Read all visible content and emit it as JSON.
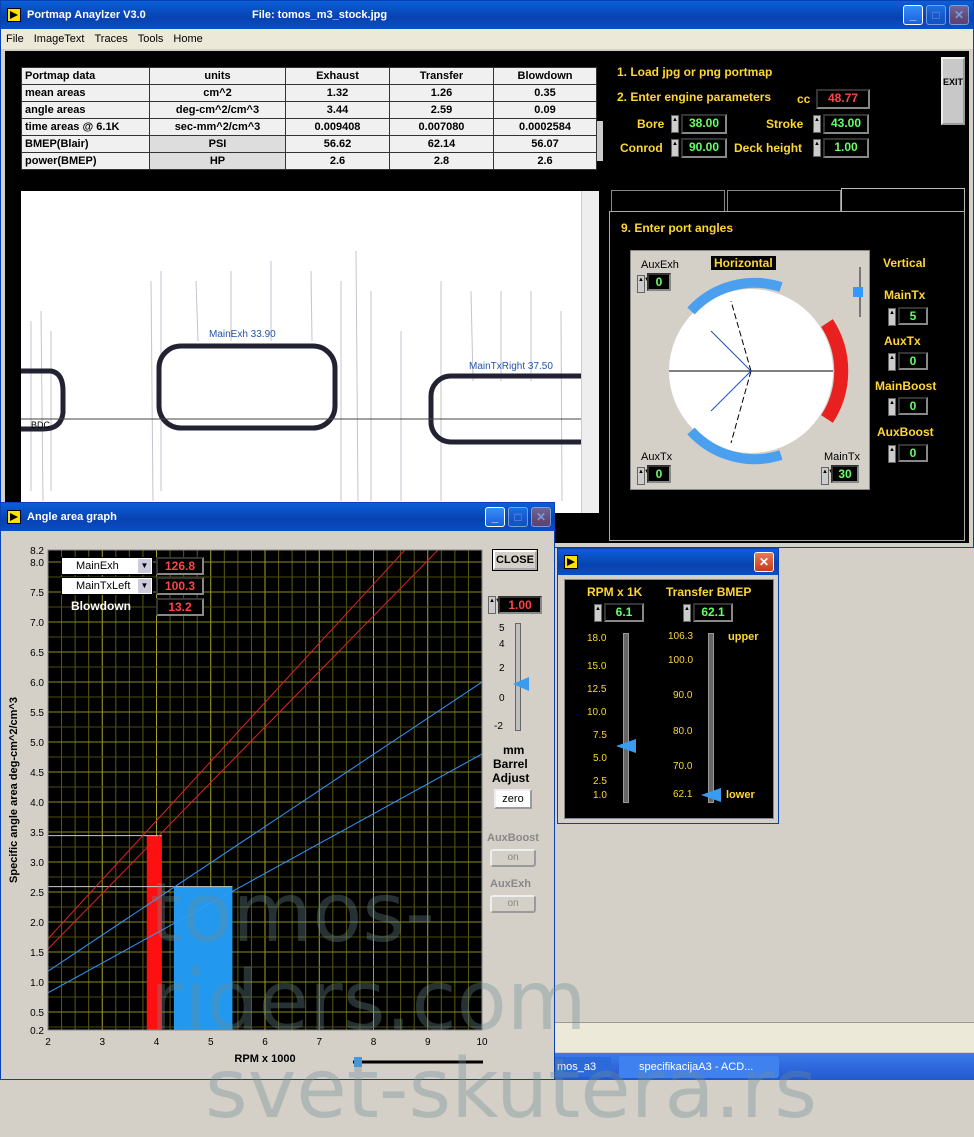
{
  "main_window": {
    "title": "Portmap Anaylzer V3.0",
    "file_label": "File: tomos_m3_stock.jpg",
    "menu": [
      "File",
      "ImageText",
      "Traces",
      "Tools",
      "Home"
    ]
  },
  "table": {
    "headers": [
      "Portmap data",
      "units",
      "Exhaust",
      "Transfer",
      "Blowdown"
    ],
    "rows": [
      [
        "mean areas",
        "cm^2",
        "1.32",
        "1.26",
        "0.35"
      ],
      [
        "angle areas",
        "deg-cm^2/cm^3",
        "3.44",
        "2.59",
        "0.09"
      ],
      [
        "time areas @ 6.1K",
        "sec-mm^2/cm^3",
        "0.009408",
        "0.007080",
        "0.0002584"
      ],
      [
        "BMEP(Blair)",
        "PSI",
        "56.62",
        "62.14",
        "56.07"
      ],
      [
        "power(BMEP)",
        "HP",
        "2.6",
        "2.8",
        "2.6"
      ]
    ]
  },
  "steps": {
    "step1": "1. Load jpg or png portmap",
    "step2": "2. Enter engine parameters",
    "step9": "9. Enter port angles"
  },
  "engine": {
    "cc_label": "cc",
    "cc": "48.77",
    "bore_label": "Bore",
    "bore": "38.00",
    "stroke_label": "Stroke",
    "stroke": "43.00",
    "conrod_label": "Conrod",
    "conrod": "90.00",
    "deck_label": "Deck height",
    "deck": "1.00"
  },
  "exit_label": "EXIT",
  "image": {
    "exh_label": "MainExh 33.90",
    "tx_label": "MainTxRight 37.50",
    "bdc_label": "BDC"
  },
  "port_angles": {
    "auxexh_label": "AuxExh",
    "auxexh": "0",
    "horizontal": "Horizontal",
    "vertical": "Vertical",
    "auxtx_label": "AuxTx",
    "auxtx": "0",
    "maintx_bottom_label": "MainTx",
    "maintx_bottom": "30",
    "vert": [
      {
        "label": "MainTx",
        "value": "5"
      },
      {
        "label": "AuxTx",
        "value": "0"
      },
      {
        "label": "MainBoost",
        "value": "0"
      },
      {
        "label": "AuxBoost",
        "value": "0"
      }
    ]
  },
  "graph_window": {
    "title": "Angle area graph",
    "close": "CLOSE",
    "legend": [
      {
        "label": "MainExh",
        "value": "126.8"
      },
      {
        "label": "MainTxLeft",
        "value": "100.3"
      },
      {
        "label": "Blowdown",
        "value": "13.2"
      }
    ],
    "adjust_value": "1.00",
    "mm": "mm",
    "barrel": "Barrel",
    "adjust": "Adjust",
    "zero": "zero",
    "auxboost": "AuxBoost",
    "auxexh": "AuxExh",
    "on": "on",
    "slider_ticks": [
      "5",
      "4",
      "2",
      "0",
      "-2"
    ]
  },
  "chart_data": {
    "type": "line",
    "xlabel": "RPM x 1000",
    "ylabel": "Specific angle area  deg-cm^2/cm^3",
    "xlim": [
      2,
      10
    ],
    "ylim": [
      0.2,
      8.2
    ],
    "xticks": [
      "2",
      "3",
      "4",
      "5",
      "6",
      "7",
      "8",
      "9",
      "10"
    ],
    "yticks": [
      "0.2",
      "0.5",
      "1.0",
      "1.5",
      "2.0",
      "2.5",
      "3.0",
      "3.5",
      "4.0",
      "4.5",
      "5.0",
      "5.5",
      "6.0",
      "6.5",
      "7.0",
      "7.5",
      "8.0",
      "8.2"
    ],
    "series": [
      {
        "name": "",
        "color": "#d22",
        "x": [
          2,
          10
        ],
        "y": [
          1.72,
          9.6
        ]
      },
      {
        "name": "",
        "color": "#d22",
        "x": [
          2,
          10
        ],
        "y": [
          1.55,
          8.95
        ]
      },
      {
        "name": "",
        "color": "#39f",
        "x": [
          2,
          10
        ],
        "y": [
          1.18,
          6.0
        ]
      },
      {
        "name": "",
        "color": "#39f",
        "x": [
          2,
          10
        ],
        "y": [
          0.82,
          4.8
        ]
      }
    ],
    "bars": [
      {
        "x0": 3.82,
        "x1": 4.1,
        "value": 3.44,
        "color": "#ff1010"
      },
      {
        "x0": 4.32,
        "x1": 5.4,
        "value": 2.59,
        "color": "#2299ee"
      }
    ],
    "hlines": [
      3.44,
      2.59
    ],
    "grid": true
  },
  "rpm_window": {
    "rpm_label": "RPM x 1K",
    "rpm": "6.1",
    "bmep_label": "Transfer BMEP",
    "bmep": "62.1",
    "rpm_ticks": [
      "18.0",
      "15.0",
      "12.5",
      "10.0",
      "7.5",
      "5.0",
      "2.5",
      "1.0"
    ],
    "bmep_ticks": [
      "106.3",
      "100.0",
      "90.0",
      "80.0",
      "70.0",
      "62.1"
    ],
    "upper": "upper",
    "lower": "lower"
  },
  "taskbar": {
    "item1": "mos_a3",
    "item2": "specifikacijaA3 - ACD..."
  },
  "watermark": {
    "line1": "tomos-riders.com",
    "line2": "svet-skutera.rs"
  }
}
